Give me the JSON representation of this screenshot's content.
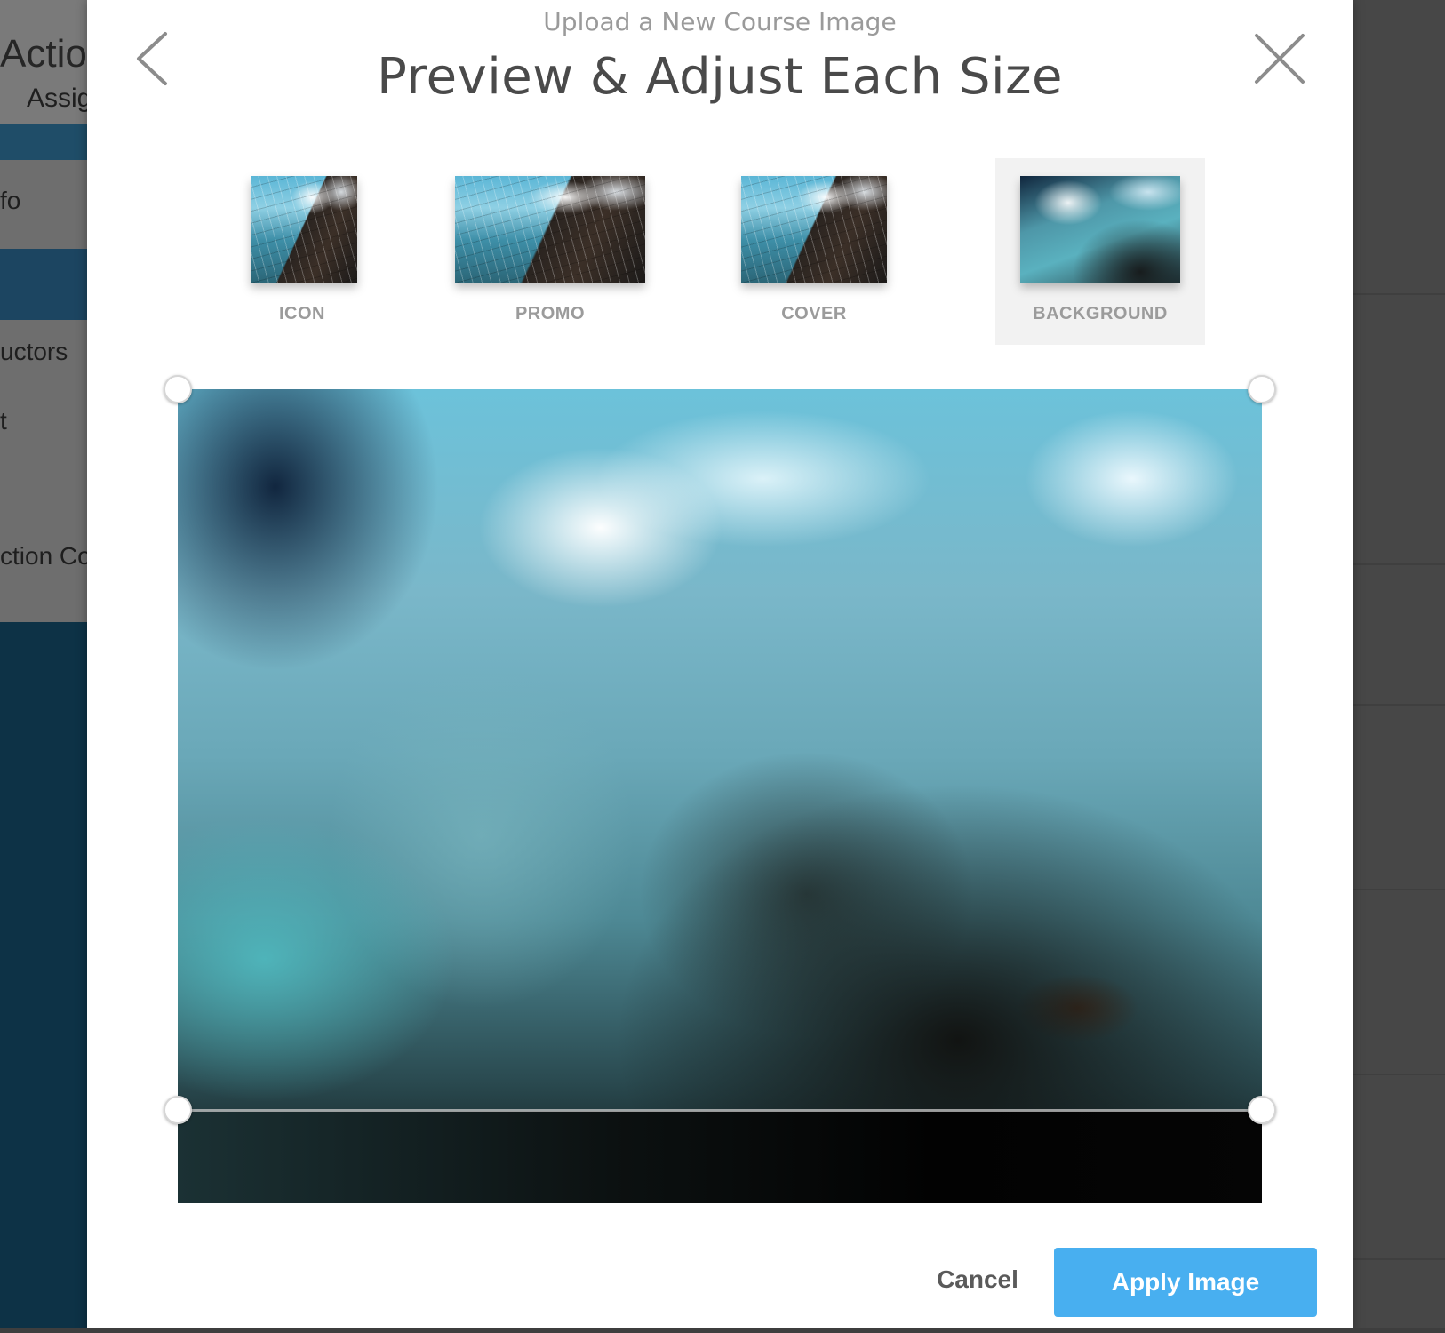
{
  "background_app": {
    "header_title": "Actio",
    "header_subtitle": "Assig",
    "nav": [
      "fo",
      "uctors",
      "t",
      "ction Coo"
    ]
  },
  "modal": {
    "subtitle": "Upload a New Course Image",
    "title": "Preview & Adjust Each Size",
    "icons": {
      "back": "chevron-left-icon",
      "close": "close-icon"
    },
    "tabs": [
      {
        "label": "ICON",
        "selected": false
      },
      {
        "label": "PROMO",
        "selected": false
      },
      {
        "label": "COVER",
        "selected": false
      },
      {
        "label": "BACKGROUND",
        "selected": true
      }
    ],
    "cancel_label": "Cancel",
    "apply_label": "Apply Image"
  },
  "colors": {
    "accent": "#48aff0",
    "title_text": "#4a4a4a",
    "tab_label": "#9b9b9b",
    "overlay": "#4a4a4a"
  }
}
